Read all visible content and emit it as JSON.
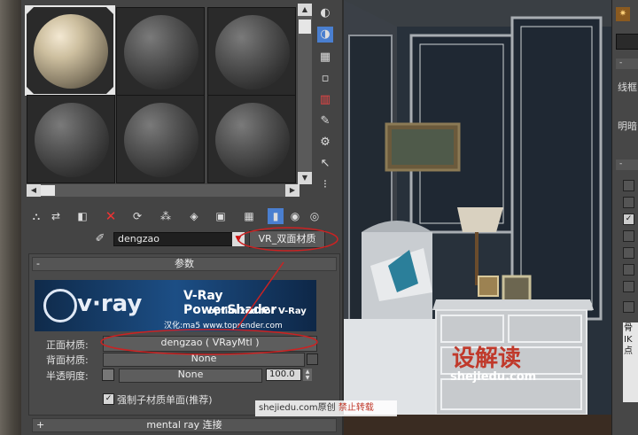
{
  "material_editor": {
    "name_value": "dengzao",
    "material_type": "VR_双面材质",
    "rollout_params_title": "参数",
    "rollout_collapse": "-",
    "banner": {
      "brand": "v·ray",
      "title": "V-Ray PowerShader",
      "subtitle": "optimized for V-Ray",
      "localization": "汉化:ma5 www.toprender.com"
    },
    "front_label": "正面材质:",
    "front_value": "dengzao  ( VRayMtl )",
    "back_label": "背面材质:",
    "back_value": "None",
    "translucency_label": "半透明度:",
    "translucency_map": "None",
    "translucency_amount": "100.0",
    "force_single_sided_label": "强制子材质单面(推荐)",
    "mentalray_title": "mental ray 连接",
    "mentalray_expand": "+"
  },
  "right_panel": {
    "label1": "线框",
    "label2": "明暗",
    "label3": "骨",
    "label4": "IK",
    "label5": "点"
  },
  "viewport": {
    "watermark_cn": "设解读",
    "watermark_url": "shejiedu.com"
  },
  "footer_watermark": {
    "site": "shejiedu.com",
    "original": "原创",
    "forbid": "禁止转载"
  },
  "colors": {
    "annotation_red": "#cc2222",
    "selected_tool": "#4a7fd0"
  }
}
